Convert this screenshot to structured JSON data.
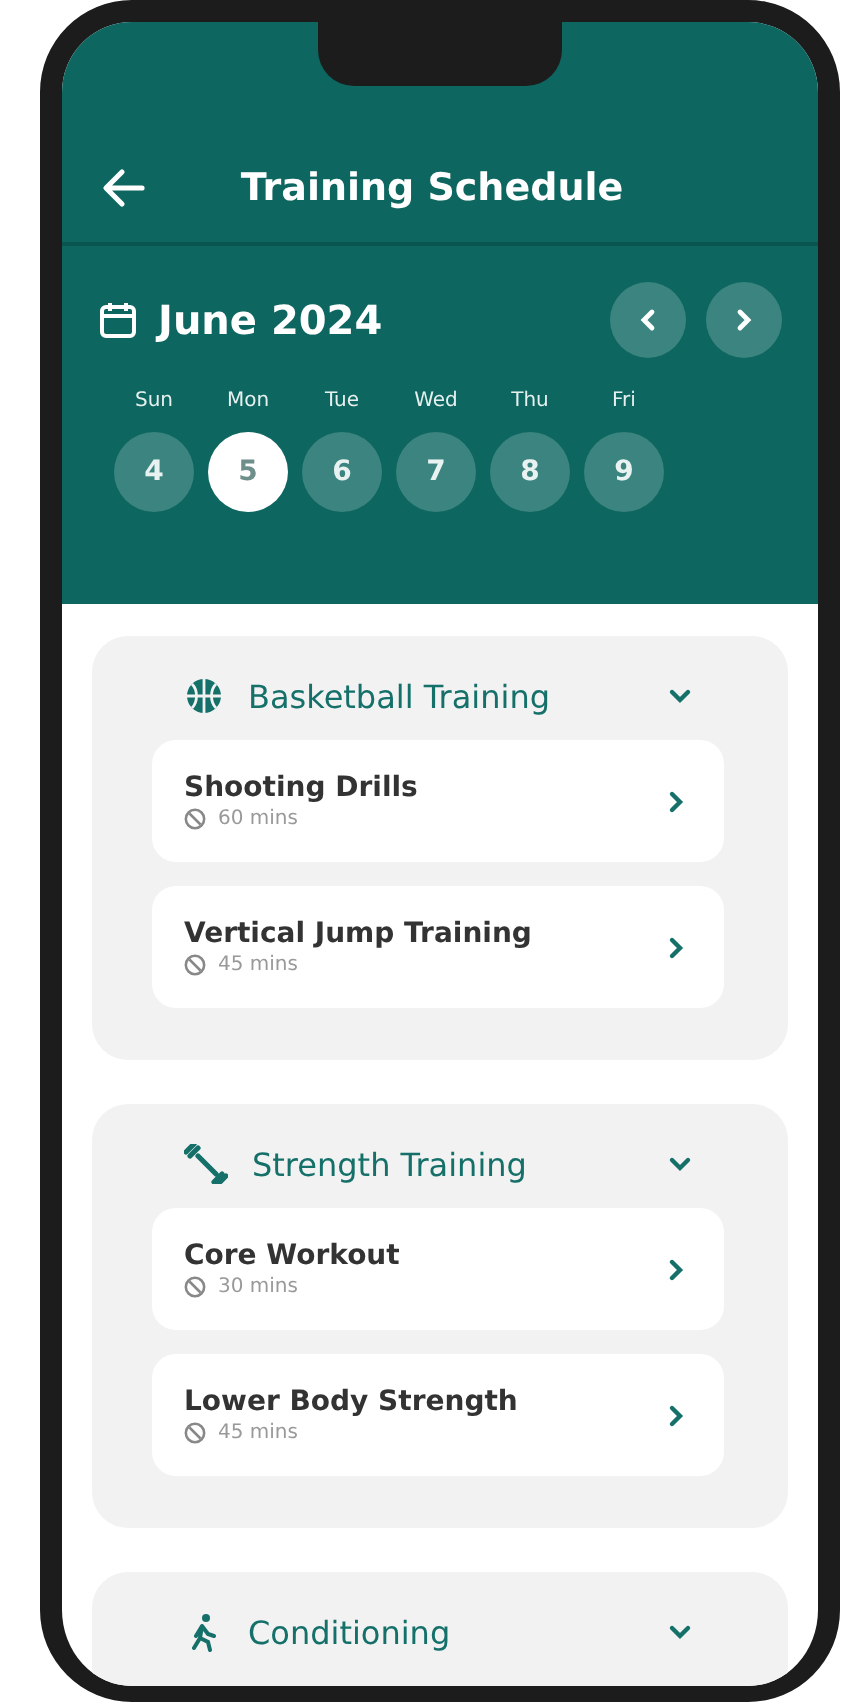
{
  "header": {
    "title": "Training Schedule"
  },
  "calendar": {
    "month": "June 2024",
    "days": [
      {
        "weekday": "Sun",
        "date": "4",
        "selected": false
      },
      {
        "weekday": "Mon",
        "date": "5",
        "selected": true
      },
      {
        "weekday": "Tue",
        "date": "6",
        "selected": false
      },
      {
        "weekday": "Wed",
        "date": "7",
        "selected": false
      },
      {
        "weekday": "Thu",
        "date": "8",
        "selected": false
      },
      {
        "weekday": "Fri",
        "date": "9",
        "selected": false
      }
    ]
  },
  "groups": [
    {
      "kind": "basketball",
      "title": "Basketball Training",
      "sessions": [
        {
          "name": "Shooting Drills",
          "duration": "60 mins"
        },
        {
          "name": "Vertical Jump Training",
          "duration": "45 mins"
        }
      ]
    },
    {
      "kind": "strength",
      "title": "Strength Training",
      "sessions": [
        {
          "name": "Core Workout",
          "duration": "30 mins"
        },
        {
          "name": "Lower Body Strength",
          "duration": "45 mins"
        }
      ]
    },
    {
      "kind": "conditioning",
      "title": "Conditioning"
    }
  ]
}
